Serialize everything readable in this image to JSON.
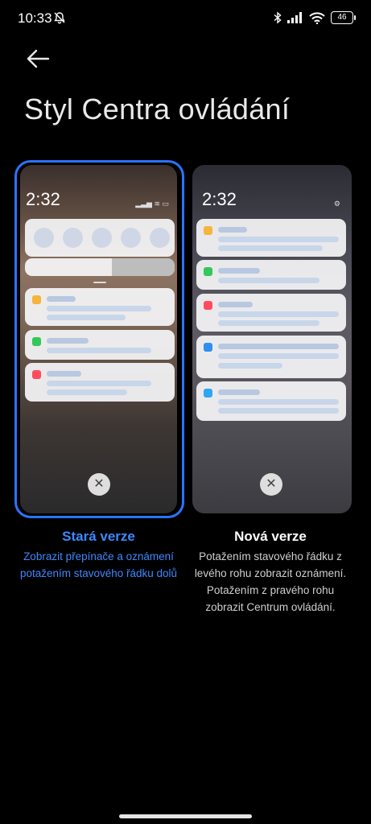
{
  "status_bar": {
    "time": "10:33",
    "battery": "46"
  },
  "page": {
    "title": "Styl Centra ovládání"
  },
  "options": [
    {
      "selected": true,
      "preview_time": "2:32",
      "title": "Stará verze",
      "description": "Zobrazit přepínače a oznámení potažením stavového řádku dolů"
    },
    {
      "selected": false,
      "preview_time": "2:32",
      "title": "Nová verze",
      "description": "Potažením stavového řádku z levého rohu zobrazit oznámení. Potažením z pravého rohu zobrazit Centrum ovládání."
    }
  ],
  "colors": {
    "accent": "#2a74ff",
    "background": "#000000"
  }
}
